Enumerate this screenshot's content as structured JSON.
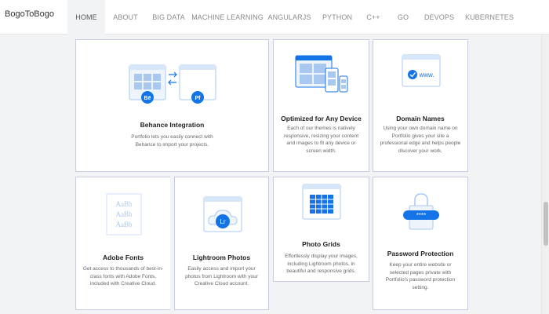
{
  "brand": "BogoToBogo",
  "nav": [
    {
      "label": "HOME",
      "active": true
    },
    {
      "label": "ABOUT"
    },
    {
      "label": "BIG DATA"
    },
    {
      "label": "MACHINE LEARNING"
    },
    {
      "label": "ANGULARJS"
    },
    {
      "label": "PYTHON"
    },
    {
      "label": "C++"
    },
    {
      "label": "GO"
    },
    {
      "label": "DEVOPS"
    },
    {
      "label": "KUBERNETES"
    }
  ],
  "colors": {
    "accent": "#1473e6",
    "icon_light": "#a9c8ef",
    "card_border": "#c9cce0",
    "background": "#f2f3f5"
  },
  "cards": {
    "behance": {
      "title": "Behance Integration",
      "desc": "Portfolio lets you easily connect with Behance to import your projects.",
      "icon": "behance-integration-icon",
      "badges": [
        "Bē",
        "Pf"
      ]
    },
    "device": {
      "title": "Optimized for Any Device",
      "desc": "Each of our themes is natively responsive, resizing your content and images to fit any device or screen width.",
      "icon": "responsive-devices-icon"
    },
    "domain": {
      "title": "Domain Names",
      "desc": "Using your own domain name on Portfolio gives your site a professional edge and helps people discover your work.",
      "icon": "domain-name-icon",
      "icon_text": "www."
    },
    "adobe": {
      "title": "Adobe Fonts",
      "desc": "Get access to thousands of best-in-class fonts with Adobe Fonts, included with Creative Cloud.",
      "icon": "fonts-icon",
      "icon_text": [
        "AaBb",
        "AaBb",
        "AaBb"
      ]
    },
    "lightroom": {
      "title": "Lightroom Photos",
      "desc": "Easily access and import your photos from Lightroom with your Creative Cloud account.",
      "icon": "lightroom-cloud-icon",
      "icon_text": "Lr"
    },
    "grids": {
      "title": "Photo Grids",
      "desc": "Effortlessly display your images, including Lightroom photos, in beautiful and responsive grids.",
      "icon": "photo-grid-icon"
    },
    "password": {
      "title": "Password Protection",
      "desc": "Keep your entire website or selected pages private with Portfolio's password protection setting.",
      "icon": "password-lock-icon",
      "icon_text": "****"
    }
  }
}
